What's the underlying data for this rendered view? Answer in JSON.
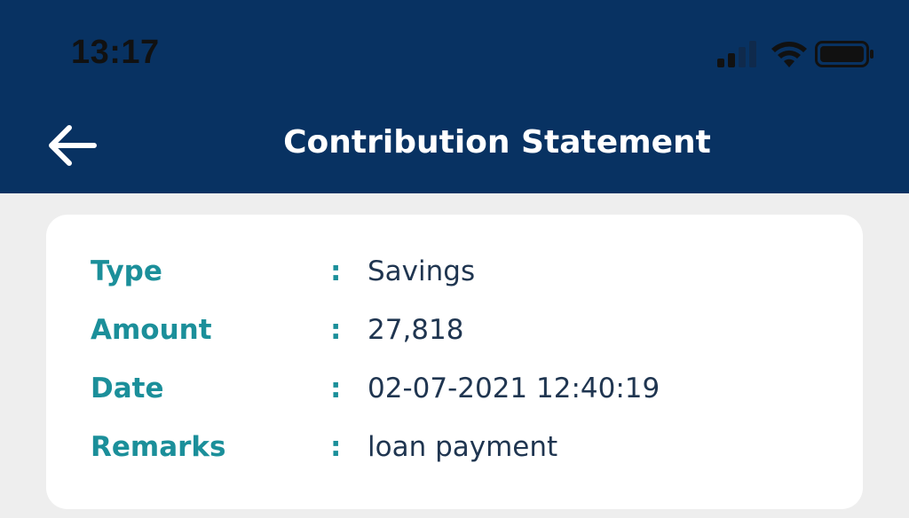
{
  "status_bar": {
    "time": "13:17",
    "icons": [
      "cellular-signal-icon",
      "wifi-icon",
      "battery-icon"
    ]
  },
  "header": {
    "title": "Contribution Statement",
    "back_icon": "arrow-left-icon",
    "background_color": "#083262"
  },
  "details": {
    "rows": [
      {
        "label": "Type",
        "separator": ":",
        "value": "Savings"
      },
      {
        "label": "Amount",
        "separator": ":",
        "value": "27,818"
      },
      {
        "label": "Date",
        "separator": ":",
        "value": "02-07-2021 12:40:19"
      },
      {
        "label": "Remarks",
        "separator": ":",
        "value": "loan payment"
      }
    ],
    "label_color": "#1b8f9a",
    "value_color": "#1f3550"
  }
}
